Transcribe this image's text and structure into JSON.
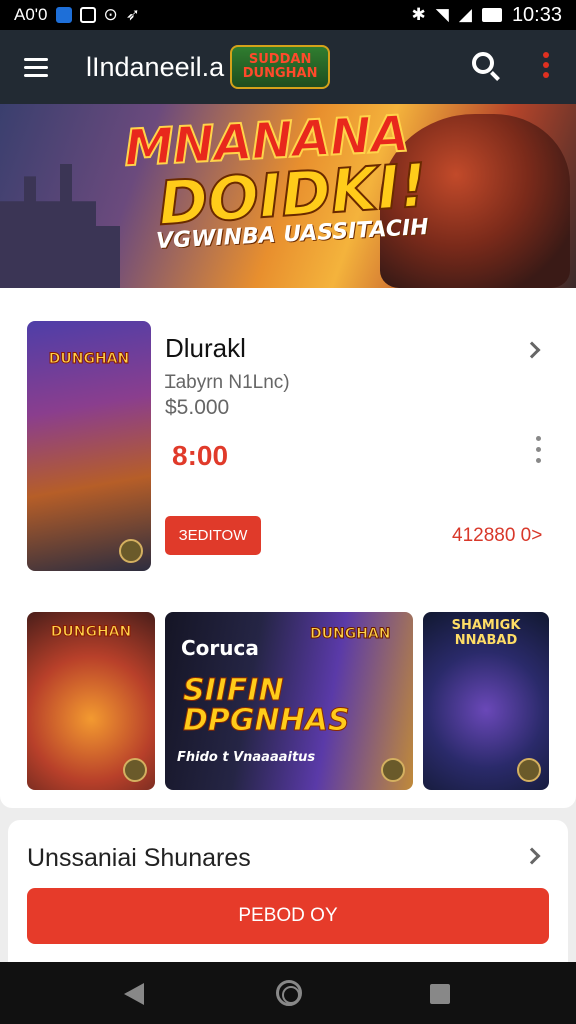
{
  "status_bar": {
    "left_text": "A0'0",
    "time": "10:33"
  },
  "app_bar": {
    "title": "lIndaneeil.a",
    "logo_text": "SUDDAN DUNGHAN"
  },
  "banner": {
    "line1": "MNANANA",
    "line2": "DOIDKI!",
    "line3": "VGWINBA UASSITACIH"
  },
  "featured": {
    "cover_title": "DUNGHAN",
    "name": "Dlurakl",
    "subtitle": "Ɪabyrn N1Lnc)",
    "old_price": "$5.000",
    "price": "8:00",
    "button_label": "ЗЕDITOW",
    "link_label": "412880 0>"
  },
  "thumbnails": [
    {
      "title": "DUNGHAN"
    },
    {
      "title_top": "Coruca",
      "title_main": "SIIFIN DPGNHAS",
      "caption": "Fhido t Vnaaaaitus",
      "logo": "DUNGHAN"
    },
    {
      "title": "SHAMIGK NNABAD"
    }
  ],
  "section": {
    "title": "Unssaniai Shunares",
    "button_label": "PEBOD OY"
  },
  "colors": {
    "accent": "#e03a2a",
    "appbar": "#222a33"
  }
}
